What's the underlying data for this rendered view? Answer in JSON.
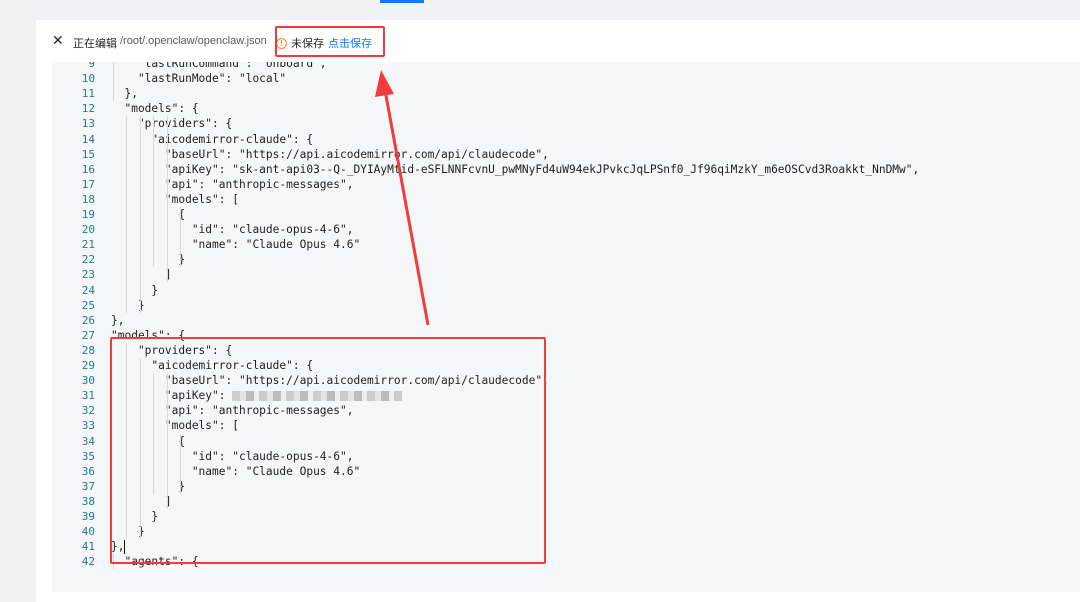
{
  "header": {
    "close_glyph": "✕",
    "editing_label": "正在编辑",
    "file_path": "/root/.openclaw/openclaw.json",
    "warn_glyph": "!",
    "unsaved_label": "未保存",
    "save_link": "点击保存"
  },
  "colors": {
    "accent": "#1677ff",
    "warning": "#fa8c16",
    "highlight_red": "#f03c3c",
    "line_number": "#237893"
  },
  "editor": {
    "lines": [
      {
        "n": "9",
        "text": "    \"lastRunCommand\": \"onboard\","
      },
      {
        "n": "10",
        "text": "    \"lastRunMode\": \"local\""
      },
      {
        "n": "11",
        "text": "  },"
      },
      {
        "n": "12",
        "text": "  \"models\": {"
      },
      {
        "n": "13",
        "text": "    \"providers\": {"
      },
      {
        "n": "14",
        "text": "      \"aicodemirror-claude\": {"
      },
      {
        "n": "15",
        "text": "        \"baseUrl\": \"https://api.aicodemirror.com/api/claudecode\","
      },
      {
        "n": "16",
        "text": "        \"apiKey\": \"sk-ant-api03--Q-_DYIAyMtid-eSFLNNFcvnU_pwMNyFd4uW94ekJPvkcJqLPSnf0_Jf96qiMzkY_m6eOSCvd3Roakkt_NnDMw\","
      },
      {
        "n": "17",
        "text": "        \"api\": \"anthropic-messages\","
      },
      {
        "n": "18",
        "text": "        \"models\": ["
      },
      {
        "n": "19",
        "text": "          {"
      },
      {
        "n": "20",
        "text": "            \"id\": \"claude-opus-4-6\","
      },
      {
        "n": "21",
        "text": "            \"name\": \"Claude Opus 4.6\""
      },
      {
        "n": "22",
        "text": "          }"
      },
      {
        "n": "23",
        "text": "        ]"
      },
      {
        "n": "24",
        "text": "      }"
      },
      {
        "n": "25",
        "text": "    }"
      },
      {
        "n": "26",
        "text": "},"
      },
      {
        "n": "27",
        "text": "\"models\": {"
      },
      {
        "n": "28",
        "text": "    \"providers\": {"
      },
      {
        "n": "29",
        "text": "      \"aicodemirror-claude\": {"
      },
      {
        "n": "30",
        "text": "        \"baseUrl\": \"https://api.aicodemirror.com/api/claudecode\","
      },
      {
        "n": "31",
        "text": "        \"apiKey\": "
      },
      {
        "n": "32",
        "text": "        \"api\": \"anthropic-messages\","
      },
      {
        "n": "33",
        "text": "        \"models\": ["
      },
      {
        "n": "34",
        "text": "          {"
      },
      {
        "n": "35",
        "text": "            \"id\": \"claude-opus-4-6\","
      },
      {
        "n": "36",
        "text": "            \"name\": \"Claude Opus 4.6\""
      },
      {
        "n": "37",
        "text": "          }"
      },
      {
        "n": "38",
        "text": "        ]"
      },
      {
        "n": "39",
        "text": "      }"
      },
      {
        "n": "40",
        "text": "    }"
      },
      {
        "n": "41",
        "text": "},"
      },
      {
        "n": "42",
        "text": "  \"agents\": {"
      }
    ]
  }
}
